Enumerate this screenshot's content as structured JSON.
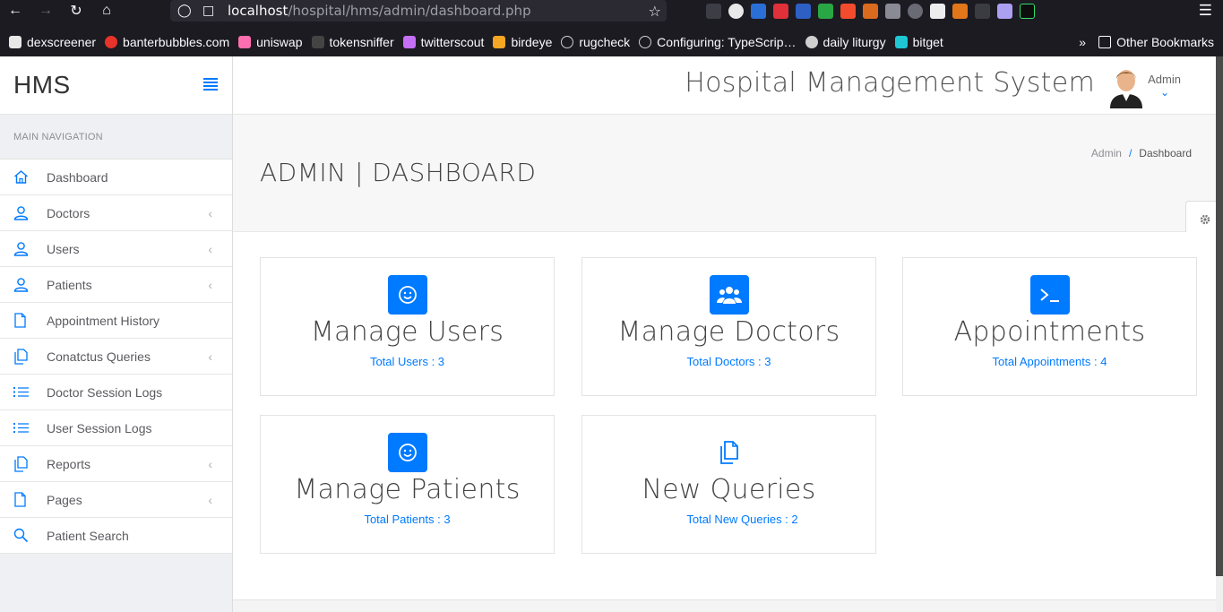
{
  "browser": {
    "url_host": "localhost",
    "url_path": "/hospital/hms/admin/dashboard.php",
    "bookmarks": [
      {
        "label": "dexscreener",
        "color": "#e8e8e8"
      },
      {
        "label": "banterbubbles.com",
        "color": "#e8332a"
      },
      {
        "label": "uniswap",
        "color": "#ff007a"
      },
      {
        "label": "tokensniffer",
        "color": "#111111"
      },
      {
        "label": "twitterscout",
        "color": "#c46ff5"
      },
      {
        "label": "birdeye",
        "color": "#f5a623"
      },
      {
        "label": "rugcheck",
        "color": "#cfcfcf"
      },
      {
        "label": "Configuring: TypeScrip…",
        "color": "#cfcfcf"
      },
      {
        "label": "daily liturgy",
        "color": "#cfcfcf"
      },
      {
        "label": "bitget",
        "color": "#1fc7d4"
      }
    ],
    "other_bookmarks": "Other Bookmarks"
  },
  "sidebar": {
    "brand": "HMS",
    "heading": "MAIN NAVIGATION",
    "items": [
      {
        "label": "Dashboard",
        "icon": "home-icon",
        "has_sub": false
      },
      {
        "label": "Doctors",
        "icon": "user-icon",
        "has_sub": true
      },
      {
        "label": "Users",
        "icon": "user-icon",
        "has_sub": true
      },
      {
        "label": "Patients",
        "icon": "user-icon",
        "has_sub": true
      },
      {
        "label": "Appointment History",
        "icon": "file-icon",
        "has_sub": false
      },
      {
        "label": "Conatctus Queries",
        "icon": "files-icon",
        "has_sub": true
      },
      {
        "label": "Doctor Session Logs",
        "icon": "list-icon",
        "has_sub": false
      },
      {
        "label": "User Session Logs",
        "icon": "list-icon",
        "has_sub": false
      },
      {
        "label": "Reports",
        "icon": "files-icon",
        "has_sub": true
      },
      {
        "label": "Pages",
        "icon": "file-icon",
        "has_sub": true
      },
      {
        "label": "Patient Search",
        "icon": "search-icon",
        "has_sub": false
      }
    ]
  },
  "header": {
    "system_title": "Hospital Management System",
    "user_name": "Admin"
  },
  "page": {
    "title": "ADMIN | DASHBOARD",
    "breadcrumb": [
      "Admin",
      "/",
      "Dashboard"
    ]
  },
  "cards": [
    {
      "title": "Manage Users",
      "link": "Total Users : 3",
      "icon": "smile-icon"
    },
    {
      "title": "Manage Doctors",
      "link": "Total Doctors : 3",
      "icon": "users-group-icon"
    },
    {
      "title": "Appointments",
      "link": "Total Appointments : 4",
      "icon": "terminal-icon"
    },
    {
      "title": "Manage Patients",
      "link": "Total Patients : 3",
      "icon": "smile-icon"
    },
    {
      "title": "New Queries",
      "link": "Total New Queries : 2",
      "icon": "files-icon"
    }
  ],
  "colors": {
    "accent": "#007aff"
  }
}
